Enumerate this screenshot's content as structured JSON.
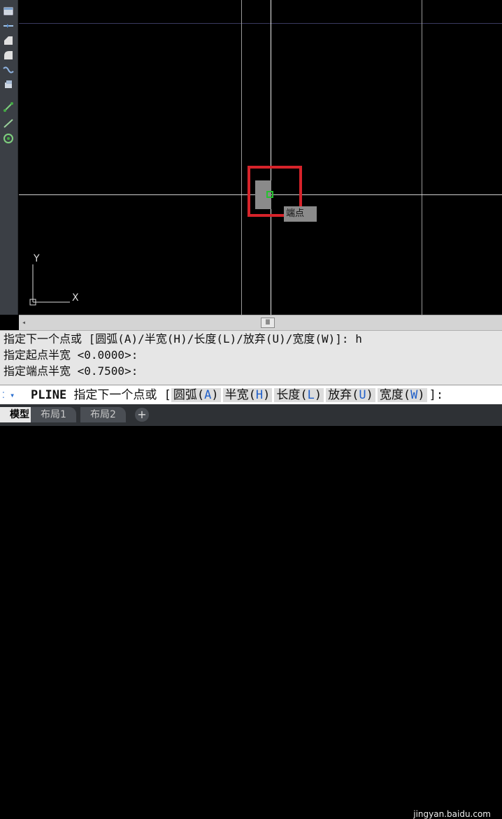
{
  "tools": [
    {
      "icon": "window-icon"
    },
    {
      "icon": "join-icon"
    },
    {
      "icon": "chamfer-icon"
    },
    {
      "icon": "fillet-icon"
    },
    {
      "icon": "blend-curve-icon"
    },
    {
      "icon": "explode-icon"
    },
    {
      "icon": "line-icon"
    },
    {
      "icon": "polyline-icon"
    },
    {
      "icon": "circle-icon"
    }
  ],
  "canvas": {
    "tooltip": "端点",
    "ucs_y": "Y",
    "ucs_x": "X"
  },
  "scrollbar": {
    "thumb_glyph": "Ⅲ",
    "left_arrow": "◂"
  },
  "history": [
    "指定下一个点或 [圆弧(A)/半宽(H)/长度(L)/放弃(U)/宽度(W)]: h",
    "指定起点半宽 <0.0000>:",
    "指定端点半宽 <0.7500>:"
  ],
  "command": {
    "icon_glyph": "⁚ ▾",
    "name": "PLINE",
    "prompt": "指定下一个点或 [",
    "options": [
      {
        "label": "圆弧(",
        "key": "A",
        "end": ")"
      },
      {
        "label": "半宽(",
        "key": "H",
        "end": ")"
      },
      {
        "label": "长度(",
        "key": "L",
        "end": ")"
      },
      {
        "label": "放弃(",
        "key": "U",
        "end": ")"
      },
      {
        "label": "宽度(",
        "key": "W",
        "end": ")"
      }
    ],
    "suffix": "]:"
  },
  "tabs": {
    "model": "模型",
    "layout1": "布局1",
    "layout2": "布局2",
    "add": "+"
  },
  "watermark": "jingyan.baidu.com",
  "colors": {
    "highlight_box": "#d6232a",
    "snap_marker": "#26c12f",
    "background": "#000000"
  }
}
